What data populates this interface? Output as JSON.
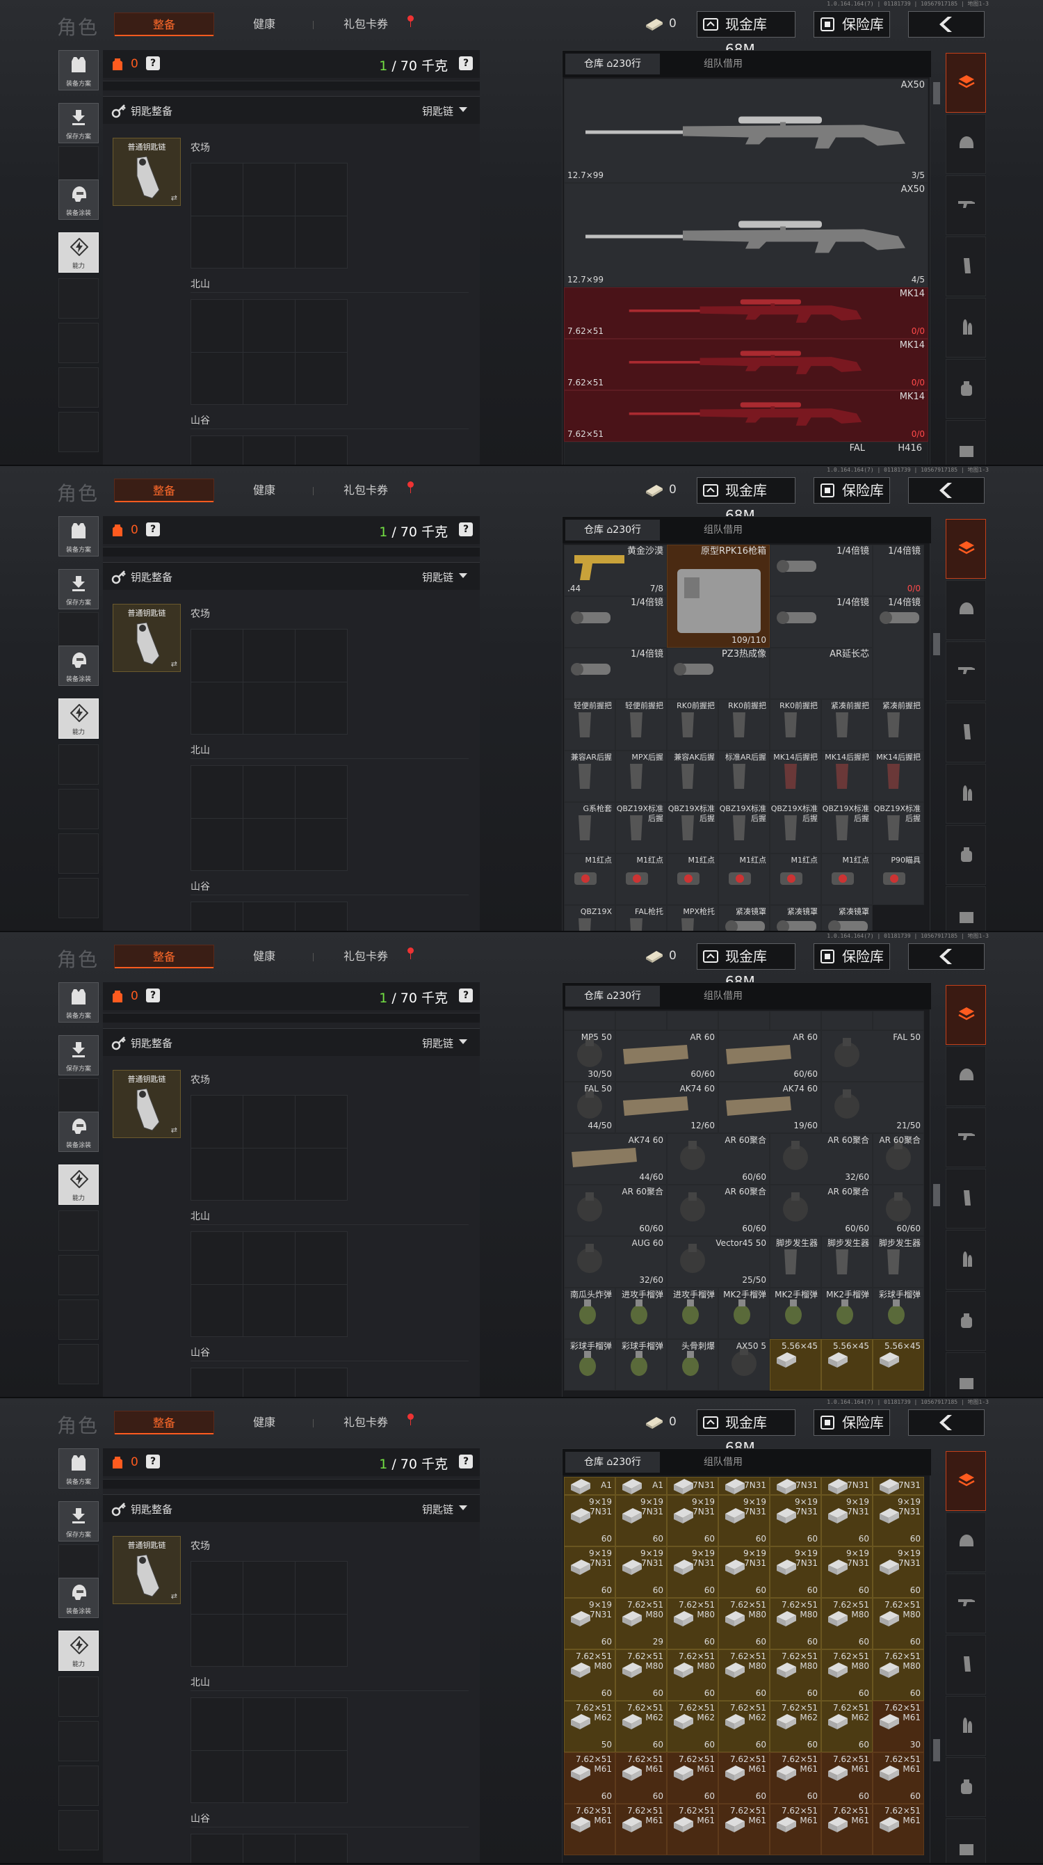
{
  "build": "1.0.164.164(7) | 01181739 | 10567917185 | 地图1-3",
  "header": {
    "title": "角色",
    "tabs": [
      "整备",
      "健康",
      "礼包卡券"
    ],
    "cash_count": "0",
    "cash_vault": "现金库 68M",
    "safe_box": "保险库"
  },
  "left_bar": [
    "装备方案",
    "保存方案",
    "装备涂装",
    "能力"
  ],
  "center": {
    "bag_count": "0",
    "capacity_current": "1",
    "capacity_text": "/ 70 千克",
    "key_title": "钥匙整备",
    "key_dropdown": "钥匙链",
    "key_card_name": "普通钥匙链",
    "key_card_arrow": "⇄",
    "zones": [
      "农场",
      "北山",
      "山谷"
    ]
  },
  "right": {
    "tab_warehouse": "仓库",
    "tab_rows": "230行",
    "tab_team": "组队借用"
  },
  "colors": {
    "accent": "#ff5b1f",
    "green": "#73e043",
    "red_cell": "#4a1318",
    "gold_cell": "#4c3b13"
  },
  "frames": [
    {
      "items": [
        {
          "name": "AX50",
          "cal": "12.7×99",
          "cnt": "3/5",
          "type": "rifle"
        },
        {
          "name": "AX50",
          "cal": "12.7×99",
          "cnt": "4/5",
          "type": "rifle"
        },
        {
          "name": "MK14",
          "cal": "7.62×51",
          "cnt": "0/0",
          "type": "rifle-red"
        },
        {
          "name": "MK14",
          "cal": "7.62×51",
          "cnt": "0/0",
          "type": "rifle-red"
        },
        {
          "name": "MK14",
          "cal": "7.62×51",
          "cnt": "0/0",
          "type": "rifle-red"
        },
        {
          "name": "FAL",
          "extra": "H416"
        }
      ]
    },
    {
      "items": [
        {
          "name": "黄金沙漠",
          "cal": ".44",
          "cnt": "7/8"
        },
        {
          "name": "原型RPK16枪箱",
          "cnt": "109/110"
        },
        {
          "name": "1/4倍镜"
        },
        {
          "name": "1/4倍镜",
          "cnt": "0/0"
        },
        {
          "name": "1/4倍镜"
        },
        {
          "name": "1/4倍镜"
        },
        {
          "name": "1/4倍镜"
        },
        {
          "name": "1/4倍镜"
        },
        {
          "name": "PZ3热成像"
        },
        {
          "name": "AR延长芯"
        },
        {
          "name": "轻便前握把"
        },
        {
          "name": "轻便前握把"
        },
        {
          "name": "RK0前握把"
        },
        {
          "name": "RK0前握把"
        },
        {
          "name": "RK0前握把"
        },
        {
          "name": "紧凑前握把"
        },
        {
          "name": "紧凑前握把"
        },
        {
          "name": "兼容AR后握"
        },
        {
          "name": "MPX后握"
        },
        {
          "name": "兼容AK后握"
        },
        {
          "name": "标准AR后握"
        },
        {
          "name": "MK14后握把"
        },
        {
          "name": "MK14后握把"
        },
        {
          "name": "MK14后握把"
        },
        {
          "name": "G系枪套"
        },
        {
          "name": "QBZ19X标准后握"
        },
        {
          "name": "QBZ19X标准后握"
        },
        {
          "name": "QBZ19X标准后握"
        },
        {
          "name": "QBZ19X标准后握"
        },
        {
          "name": "QBZ19X标准后握"
        },
        {
          "name": "QBZ19X标准后握"
        },
        {
          "name": "M1红点"
        },
        {
          "name": "M1红点"
        },
        {
          "name": "M1红点"
        },
        {
          "name": "M1红点"
        },
        {
          "name": "M1红点"
        },
        {
          "name": "M1红点"
        },
        {
          "name": "P90瞄具"
        },
        {
          "name": "QBZ19X"
        },
        {
          "name": "FAL枪托"
        },
        {
          "name": "MPX枪托"
        },
        {
          "name": "紧凑镜罩"
        },
        {
          "name": "紧凑镜罩"
        },
        {
          "name": "紧凑镜罩"
        }
      ]
    },
    {
      "items": [
        {
          "name": "MP5 50",
          "cnt": "30/50"
        },
        {
          "name": "AR 60",
          "cnt": "60/60"
        },
        {
          "name": "AR 60",
          "cnt": "60/60"
        },
        {
          "name": "FAL 50",
          "cnt": ""
        },
        {
          "name": "FAL 50",
          "cnt": "44/50"
        },
        {
          "name": "AK74 60",
          "cnt": "12/60"
        },
        {
          "name": "AK74 60",
          "cnt": "19/60"
        },
        {
          "name": "",
          "cnt": "21/50"
        },
        {
          "name": "AK74 60",
          "cnt": "44/60"
        },
        {
          "name": "AR 60聚合",
          "cnt": "60/60"
        },
        {
          "name": "AR 60聚合",
          "cnt": "32/60"
        },
        {
          "name": "AR 60聚合",
          "cnt": ""
        },
        {
          "name": "AR 60聚合",
          "cnt": "60/60"
        },
        {
          "name": "AR 60聚合",
          "cnt": "60/60"
        },
        {
          "name": "AR 60聚合",
          "cnt": "60/60"
        },
        {
          "name": "",
          "cnt": "60/60"
        },
        {
          "name": "AUG 60",
          "cnt": "32/60"
        },
        {
          "name": "Vector45 50",
          "cnt": "25/50"
        },
        {
          "name": "脚步发生器"
        },
        {
          "name": "脚步发生器"
        },
        {
          "name": "脚步发生器"
        },
        {
          "name": "南瓜头炸弹"
        },
        {
          "name": "进攻手榴弹"
        },
        {
          "name": "进攻手榴弹"
        },
        {
          "name": "MK2手榴弹"
        },
        {
          "name": "MK2手榴弹"
        },
        {
          "name": "MK2手榴弹"
        },
        {
          "name": "彩球手榴弹"
        },
        {
          "name": "彩球手榴弹"
        },
        {
          "name": "彩球手榴弹"
        },
        {
          "name": "头骨刺爆"
        },
        {
          "name": "AX50 5"
        },
        {
          "name": "5.56×45"
        },
        {
          "name": "5.56×45"
        },
        {
          "name": "5.56×45"
        }
      ]
    },
    {
      "rows": [
        [
          {
            "n": "A1"
          },
          {
            "n": "A1"
          },
          {
            "n": "7N31"
          },
          {
            "n": "7N31"
          },
          {
            "n": "7N31"
          },
          {
            "n": "7N31"
          },
          {
            "n": "7N31"
          }
        ],
        [
          {
            "c": "9×19",
            "n": "7N31",
            "v": "60"
          },
          {
            "c": "9×19",
            "n": "7N31",
            "v": "60"
          },
          {
            "c": "9×19",
            "n": "7N31",
            "v": "60"
          },
          {
            "c": "9×19",
            "n": "7N31",
            "v": "60"
          },
          {
            "c": "9×19",
            "n": "7N31",
            "v": "60"
          },
          {
            "c": "9×19",
            "n": "7N31",
            "v": "60"
          },
          {
            "c": "9×19",
            "n": "7N31",
            "v": "60"
          }
        ],
        [
          {
            "c": "9×19",
            "n": "7N31",
            "v": "60"
          },
          {
            "c": "9×19",
            "n": "7N31",
            "v": "60"
          },
          {
            "c": "9×19",
            "n": "7N31",
            "v": "60"
          },
          {
            "c": "9×19",
            "n": "7N31",
            "v": "60"
          },
          {
            "c": "9×19",
            "n": "7N31",
            "v": "60"
          },
          {
            "c": "9×19",
            "n": "7N31",
            "v": "60"
          },
          {
            "c": "9×19",
            "n": "7N31",
            "v": "60"
          }
        ],
        [
          {
            "c": "9×19",
            "n": "7N31",
            "v": "60"
          },
          {
            "c": "7.62×51",
            "n": "M80",
            "v": "29"
          },
          {
            "c": "7.62×51",
            "n": "M80",
            "v": "60"
          },
          {
            "c": "7.62×51",
            "n": "M80",
            "v": "60"
          },
          {
            "c": "7.62×51",
            "n": "M80",
            "v": "60"
          },
          {
            "c": "7.62×51",
            "n": "M80",
            "v": "60"
          },
          {
            "c": "7.62×51",
            "n": "M80",
            "v": "60"
          }
        ],
        [
          {
            "c": "7.62×51",
            "n": "M80",
            "v": "60"
          },
          {
            "c": "7.62×51",
            "n": "M80",
            "v": "60"
          },
          {
            "c": "7.62×51",
            "n": "M80",
            "v": "60"
          },
          {
            "c": "7.62×51",
            "n": "M80",
            "v": "60"
          },
          {
            "c": "7.62×51",
            "n": "M80",
            "v": "60"
          },
          {
            "c": "7.62×51",
            "n": "M80",
            "v": "60"
          },
          {
            "c": "7.62×51",
            "n": "M80",
            "v": "60"
          }
        ],
        [
          {
            "c": "7.62×51",
            "n": "M62",
            "v": "50"
          },
          {
            "c": "7.62×51",
            "n": "M62",
            "v": "60"
          },
          {
            "c": "7.62×51",
            "n": "M62",
            "v": "60"
          },
          {
            "c": "7.62×51",
            "n": "M62",
            "v": "60"
          },
          {
            "c": "7.62×51",
            "n": "M62",
            "v": "60"
          },
          {
            "c": "7.62×51",
            "n": "M62",
            "v": "60"
          },
          {
            "c": "7.62×51",
            "n": "M61",
            "v": "30"
          }
        ],
        [
          {
            "c": "7.62×51",
            "n": "M61",
            "v": "60"
          },
          {
            "c": "7.62×51",
            "n": "M61",
            "v": "60"
          },
          {
            "c": "7.62×51",
            "n": "M61",
            "v": "60"
          },
          {
            "c": "7.62×51",
            "n": "M61",
            "v": "60"
          },
          {
            "c": "7.62×51",
            "n": "M61",
            "v": "60"
          },
          {
            "c": "7.62×51",
            "n": "M61",
            "v": "60"
          },
          {
            "c": "7.62×51",
            "n": "M61",
            "v": "60"
          }
        ],
        [
          {
            "c": "7.62×51",
            "n": "M61"
          },
          {
            "c": "7.62×51",
            "n": "M61"
          },
          {
            "c": "7.62×51",
            "n": "M61"
          },
          {
            "c": "7.62×51",
            "n": "M61"
          },
          {
            "c": "7.62×51",
            "n": "M61"
          },
          {
            "c": "7.62×51",
            "n": "M61"
          },
          {
            "c": "7.62×51",
            "n": "M61"
          }
        ]
      ]
    }
  ]
}
